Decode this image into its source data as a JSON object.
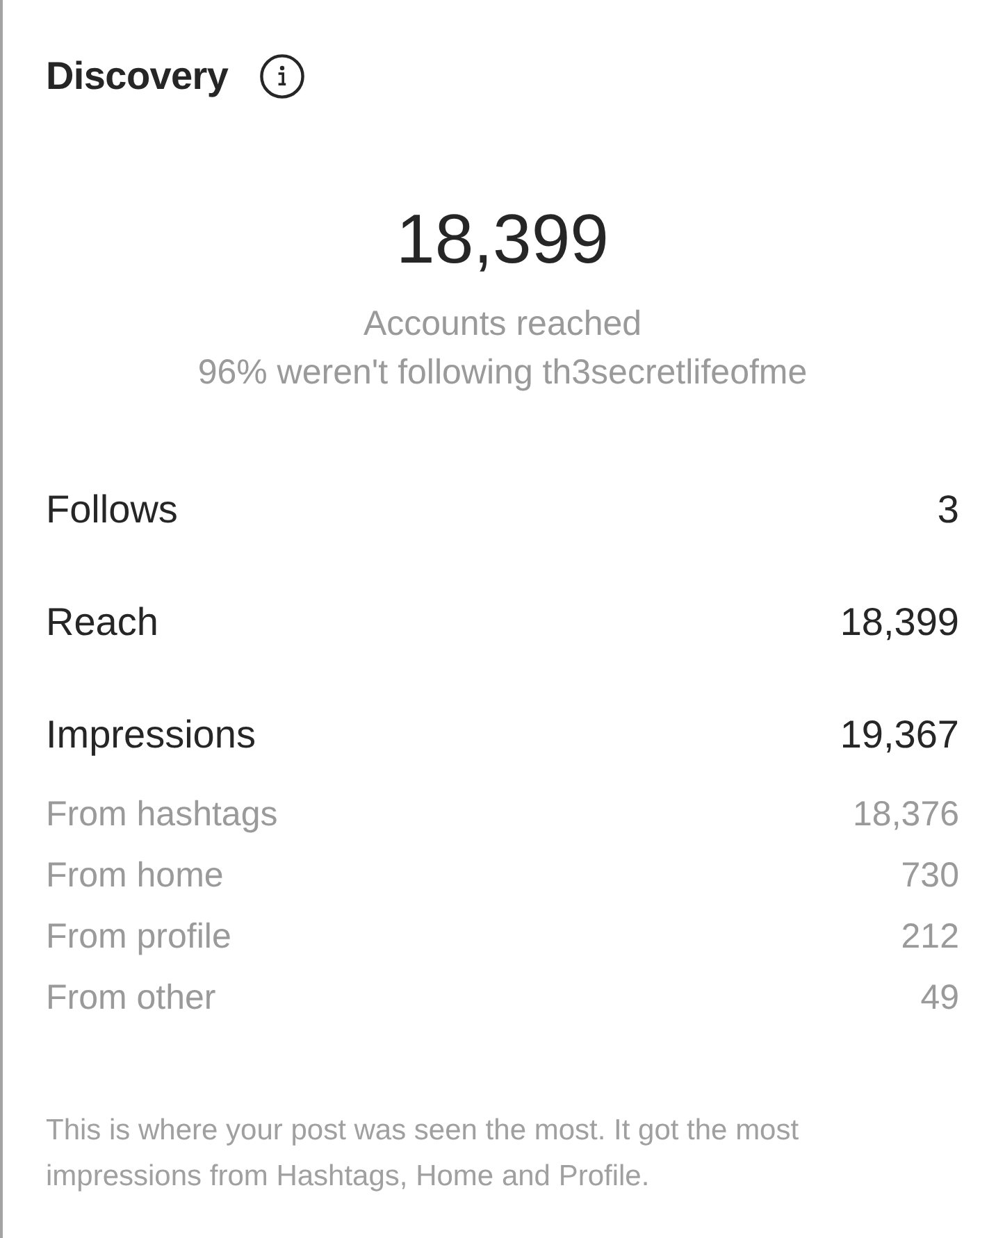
{
  "header": {
    "title": "Discovery"
  },
  "summary": {
    "value": "18,399",
    "label": "Accounts reached",
    "note": "96% weren't following th3secretlifeofme"
  },
  "metrics": [
    {
      "kind": "primary",
      "label": "Follows",
      "value": "3"
    },
    {
      "kind": "primary",
      "label": "Reach",
      "value": "18,399"
    },
    {
      "kind": "primary",
      "label": "Impressions",
      "value": "19,367"
    },
    {
      "kind": "secondary",
      "label": "From hashtags",
      "value": "18,376"
    },
    {
      "kind": "secondary",
      "label": "From home",
      "value": "730"
    },
    {
      "kind": "secondary",
      "label": "From profile",
      "value": "212"
    },
    {
      "kind": "secondary",
      "label": "From other",
      "value": "49"
    }
  ],
  "footer": "This is where your post was seen the most. It got the most impressions from Hashtags, Home and Profile."
}
